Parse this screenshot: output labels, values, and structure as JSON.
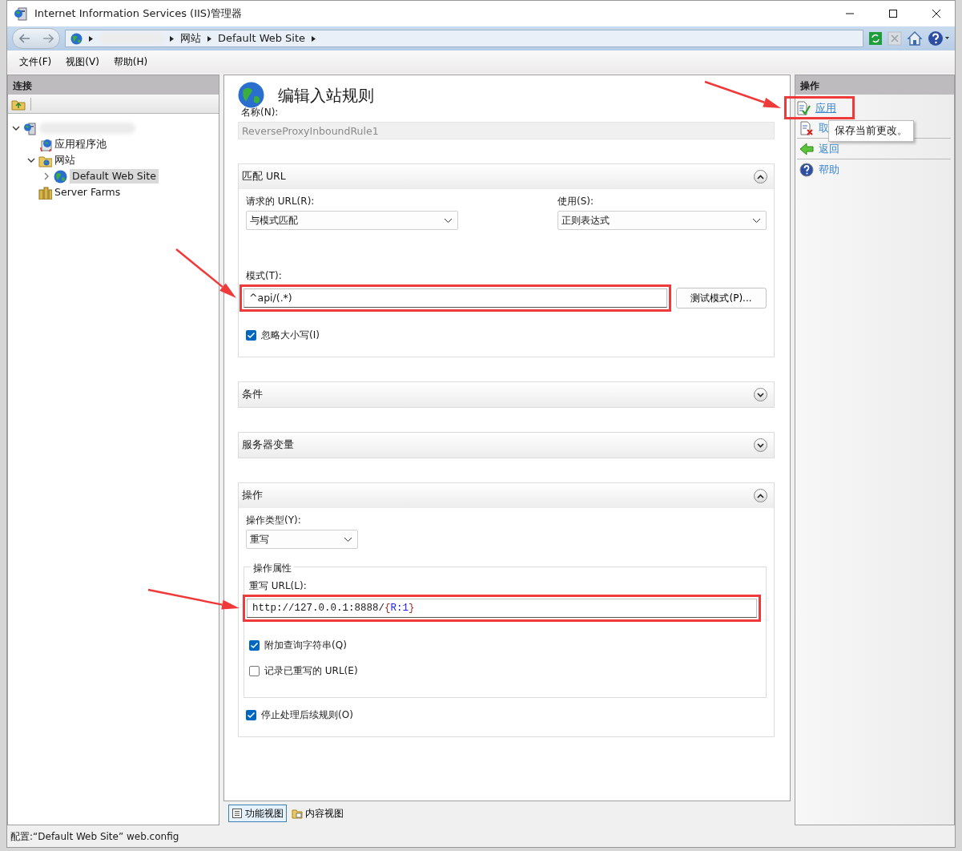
{
  "window": {
    "title": "Internet Information Services (IIS)管理器"
  },
  "address": {
    "crumbs": [
      {
        "kind": "redacted"
      },
      {
        "kind": "text",
        "text": "网站"
      },
      {
        "kind": "text",
        "text": "Default Web Site"
      }
    ]
  },
  "menu": [
    "文件(F)",
    "视图(V)",
    "帮助(H)"
  ],
  "connections": {
    "title": "连接",
    "tree": [
      {
        "kind": "server",
        "redacted": true,
        "expanded": true,
        "selected": false,
        "children": [
          {
            "kind": "pool",
            "label": "应用程序池",
            "selected": false
          },
          {
            "kind": "folder",
            "label": "网站",
            "expanded": true,
            "selected": false,
            "children": [
              {
                "kind": "site",
                "label": "Default Web Site",
                "expanded": false,
                "selected": true
              }
            ]
          },
          {
            "kind": "farm",
            "label": "Server Farms",
            "selected": false
          }
        ]
      }
    ]
  },
  "editor": {
    "title": "编辑入站规则",
    "name_label": "名称(N):",
    "name_value": "ReverseProxyInboundRule1",
    "sections": [
      {
        "title": "匹配 URL",
        "expanded": true,
        "items": [
          {
            "kind": "select_pair",
            "fields": [
              {
                "label": "请求的 URL(R):",
                "value": "与模式匹配"
              },
              {
                "label": "使用(S):",
                "value": "正则表达式"
              }
            ]
          },
          {
            "kind": "input",
            "label": "模式(T):",
            "parts": [
              {
                "text": "^api/(.*)",
                "color": "#1a1a1a"
              }
            ],
            "button": "测试模式(P)...",
            "annotated": true
          },
          {
            "kind": "checkbox",
            "label": "忽略大小写(I)",
            "checked": true
          }
        ]
      },
      {
        "title": "条件",
        "expanded": false
      },
      {
        "title": "服务器变量",
        "expanded": false
      },
      {
        "title": "操作",
        "expanded": true,
        "items": [
          {
            "kind": "select",
            "label": "操作类型(Y):",
            "value": "重写"
          },
          {
            "kind": "group",
            "title": "操作属性",
            "items": [
              {
                "kind": "input",
                "label": "重写 URL(L):",
                "mono": true,
                "parts": [
                  {
                    "text": "http://127.0.0.1:8888/",
                    "color": "#1a1a1a"
                  },
                  {
                    "text": "{",
                    "color": "#a52a2a"
                  },
                  {
                    "text": "R:1",
                    "color": "#1c1cf0"
                  },
                  {
                    "text": "}",
                    "color": "#a52a2a"
                  }
                ],
                "annotated": true
              },
              {
                "kind": "checkbox",
                "label": "附加查询字符串(Q)",
                "checked": true
              },
              {
                "kind": "checkbox",
                "label": "记录已重写的 URL(E)",
                "checked": false
              }
            ]
          },
          {
            "kind": "checkbox",
            "label": "停止处理后续规则(O)",
            "checked": true
          }
        ]
      }
    ]
  },
  "view_tabs": [
    {
      "label": "功能视图",
      "selected": true
    },
    {
      "label": "内容视图",
      "selected": false
    }
  ],
  "actions": {
    "title": "操作",
    "items": [
      {
        "kind": "apply",
        "label": "应用",
        "annotated": true,
        "divider_after": false
      },
      {
        "kind": "cancel",
        "label": "取",
        "divider_after": true
      },
      {
        "kind": "back",
        "label": "返回",
        "divider_after": true
      },
      {
        "kind": "help",
        "label": "帮助",
        "divider_after": false
      }
    ],
    "tooltip": "保存当前更改。"
  },
  "status_bar": "配置:“Default Web Site” web.config"
}
